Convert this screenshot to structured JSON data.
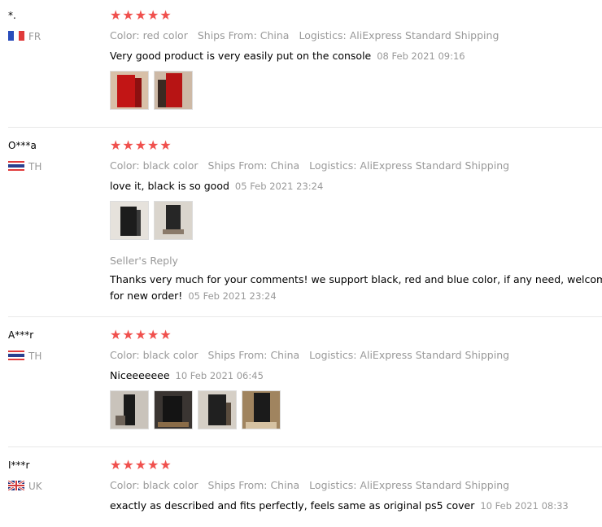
{
  "reviews": [
    {
      "user": "*.",
      "country": "FR",
      "stars": "★★★★★",
      "color": "Color: red color",
      "ships": "Ships From: China",
      "logistics": "Logistics: AliExpress Standard Shipping",
      "text": "Very good product is very easily put on the console",
      "date": "08 Feb 2021 09:16"
    },
    {
      "user": "O***a",
      "country": "TH",
      "stars": "★★★★★",
      "color": "Color: black color",
      "ships": "Ships From: China",
      "logistics": "Logistics: AliExpress Standard Shipping",
      "text": "love it, black is so good",
      "date": "05 Feb 2021 23:24",
      "seller_reply_label": "Seller's Reply",
      "seller_reply_line1": "Thanks very much for your comments! we support black, red and blue color, if any need, welcome to c",
      "seller_reply_line2": "for new order!",
      "seller_reply_date": "05 Feb 2021 23:24"
    },
    {
      "user": "A***r",
      "country": "TH",
      "stars": "★★★★★",
      "color": "Color: black color",
      "ships": "Ships From: China",
      "logistics": "Logistics: AliExpress Standard Shipping",
      "text": "Niceeeeeee",
      "date": "10 Feb 2021 06:45"
    },
    {
      "user": "I***r",
      "country": "UK",
      "stars": "★★★★★",
      "color": "Color: black color",
      "ships": "Ships From: China",
      "logistics": "Logistics: AliExpress Standard Shipping",
      "text": "exactly as described and fits perfectly, feels same as original ps5 cover",
      "date": "10 Feb 2021 08:33"
    }
  ],
  "colors": {
    "star": "#f0504d",
    "muted": "#999999",
    "divider": "#e8e8e8"
  }
}
